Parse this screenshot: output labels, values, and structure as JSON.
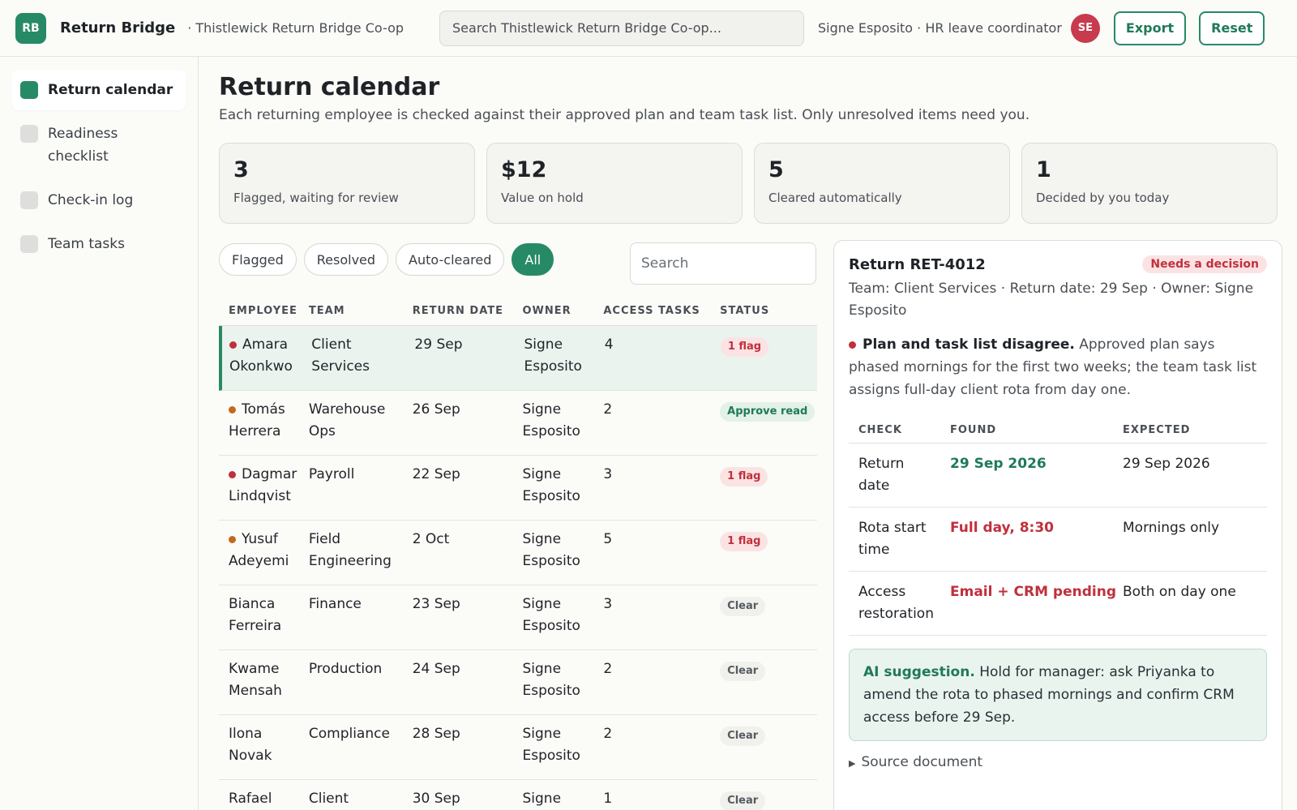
{
  "header": {
    "logo_text": "RB",
    "app_name": "Return Bridge",
    "org_name": "· Thistlewick Return Bridge Co-op",
    "search_placeholder": "Search Thistlewick Return Bridge Co-op...",
    "user_name": "Signe Esposito · HR leave coordinator",
    "avatar_initials": "SE",
    "export_label": "Export",
    "reset_label": "Reset"
  },
  "sidebar": {
    "items": [
      {
        "label": "Return calendar",
        "active": true
      },
      {
        "label": "Readiness checklist",
        "active": false
      },
      {
        "label": "Check-in log",
        "active": false
      },
      {
        "label": "Team tasks",
        "active": false
      }
    ]
  },
  "main": {
    "title": "Return calendar",
    "subtitle": "Each returning employee is checked against their approved plan and team task list. Only unresolved items need you.",
    "stats": [
      {
        "value": "3",
        "label": "Flagged, waiting for review"
      },
      {
        "value": "$12",
        "label": "Value on hold"
      },
      {
        "value": "5",
        "label": "Cleared automatically"
      },
      {
        "value": "1",
        "label": "Decided by you today"
      }
    ],
    "filters": [
      "Flagged",
      "Resolved",
      "Auto-cleared",
      "All"
    ],
    "active_filter": "All",
    "search_placeholder": "Search"
  },
  "table": {
    "columns": [
      "EMPLOYEE",
      "TEAM",
      "RETURN DATE",
      "OWNER",
      "ACCESS TASKS",
      "STATUS"
    ],
    "rows": [
      {
        "first": "Amara",
        "last": "Okonkwo",
        "team1": "Client",
        "team2": "Services",
        "date": "29 Sep",
        "own1": "Signe",
        "own2": "Esposito",
        "tasks": "4",
        "status": "1 flag",
        "kind": "flag",
        "dot": "#c0303d",
        "selected": true
      },
      {
        "first": "Tomás",
        "last": "Herrera",
        "team1": "Warehouse",
        "team2": "Ops",
        "date": "26 Sep",
        "own1": "Signe",
        "own2": "Esposito",
        "tasks": "2",
        "status": "Approve read",
        "kind": "approve",
        "dot": "#c26a1a",
        "selected": false
      },
      {
        "first": "Dagmar",
        "last": "Lindqvist",
        "team1": "Payroll",
        "team2": "",
        "date": "22 Sep",
        "own1": "Signe",
        "own2": "Esposito",
        "tasks": "3",
        "status": "1 flag",
        "kind": "flag",
        "dot": "#c0303d",
        "selected": false
      },
      {
        "first": "Yusuf",
        "last": "Adeyemi",
        "team1": "Field",
        "team2": "Engineering",
        "date": "2 Oct",
        "own1": "Signe",
        "own2": "Esposito",
        "tasks": "5",
        "status": "1 flag",
        "kind": "flag",
        "dot": "#c26a1a",
        "selected": false
      },
      {
        "first": "Bianca",
        "last": "Ferreira",
        "team1": "Finance",
        "team2": "",
        "date": "23 Sep",
        "own1": "Signe",
        "own2": "Esposito",
        "tasks": "3",
        "status": "Clear",
        "kind": "clear",
        "dot": "",
        "selected": false
      },
      {
        "first": "Kwame",
        "last": "Mensah",
        "team1": "Production",
        "team2": "",
        "date": "24 Sep",
        "own1": "Signe",
        "own2": "Esposito",
        "tasks": "2",
        "status": "Clear",
        "kind": "clear",
        "dot": "",
        "selected": false
      },
      {
        "first": "Ilona",
        "last": "Novak",
        "team1": "Compliance",
        "team2": "",
        "date": "28 Sep",
        "own1": "Signe",
        "own2": "Esposito",
        "tasks": "2",
        "status": "Clear",
        "kind": "clear",
        "dot": "",
        "selected": false
      },
      {
        "first": "Rafael",
        "last": "",
        "team1": "Client",
        "team2": "",
        "date": "30 Sep",
        "own1": "Signe",
        "own2": "",
        "tasks": "1",
        "status": "Clear",
        "kind": "clear",
        "dot": "",
        "selected": false
      }
    ]
  },
  "detail": {
    "title": "Return RET-4012",
    "badge": "Needs a decision",
    "meta": "Team: Client Services · Return date: 29 Sep · Owner: Signe Esposito",
    "summary_bold": "Plan and task list disagree.",
    "summary_text": "Approved plan says phased mornings for the first two weeks; the team task list assigns full-day client rota from day one.",
    "check_columns": [
      "CHECK",
      "FOUND",
      "EXPECTED"
    ],
    "checks": [
      {
        "check": "Return date",
        "found": "29 Sep 2026",
        "expected": "29 Sep 2026",
        "ok": true
      },
      {
        "check": "Rota start time",
        "found": "Full day, 8:30",
        "expected": "Mornings only",
        "ok": false
      },
      {
        "check": "Access restoration",
        "found": "Email + CRM pending",
        "expected": "Both on day one",
        "ok": false
      }
    ],
    "ai_label": "AI suggestion.",
    "ai_text": "Hold for manager: ask Priyanka to amend the rota to phased mornings and confirm CRM access before 29 Sep.",
    "source_label": "Source document"
  },
  "colors": {
    "accent": "#278a66",
    "danger": "#c0303d",
    "warning": "#c26a1a"
  }
}
